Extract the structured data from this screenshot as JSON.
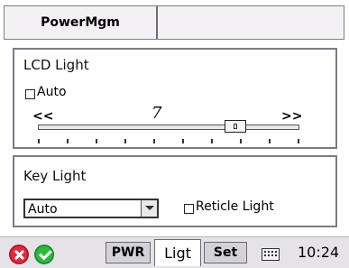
{
  "window": {
    "title": "PowerMgm"
  },
  "lcd_light": {
    "title": "LCD Light",
    "auto_label": "Auto",
    "auto_checked": false,
    "slider": {
      "left_label": "<<",
      "right_label": ">>",
      "value": 7,
      "value_text": "7",
      "max": 9,
      "tick_count": 10
    }
  },
  "key_light": {
    "title": "Key Light",
    "select_value": "Auto",
    "reticle_label": "Reticle Light",
    "reticle_checked": false
  },
  "taskbar": {
    "tabs": [
      {
        "label": "PWR",
        "active": false
      },
      {
        "label": "Ligt",
        "active": true
      },
      {
        "label": "Set",
        "active": false
      }
    ],
    "time": "10:24",
    "icons": [
      "close-icon",
      "ok-icon",
      "keyboard-icon"
    ],
    "colors": {
      "close": "#e6283f",
      "ok": "#2dbb3f"
    }
  }
}
